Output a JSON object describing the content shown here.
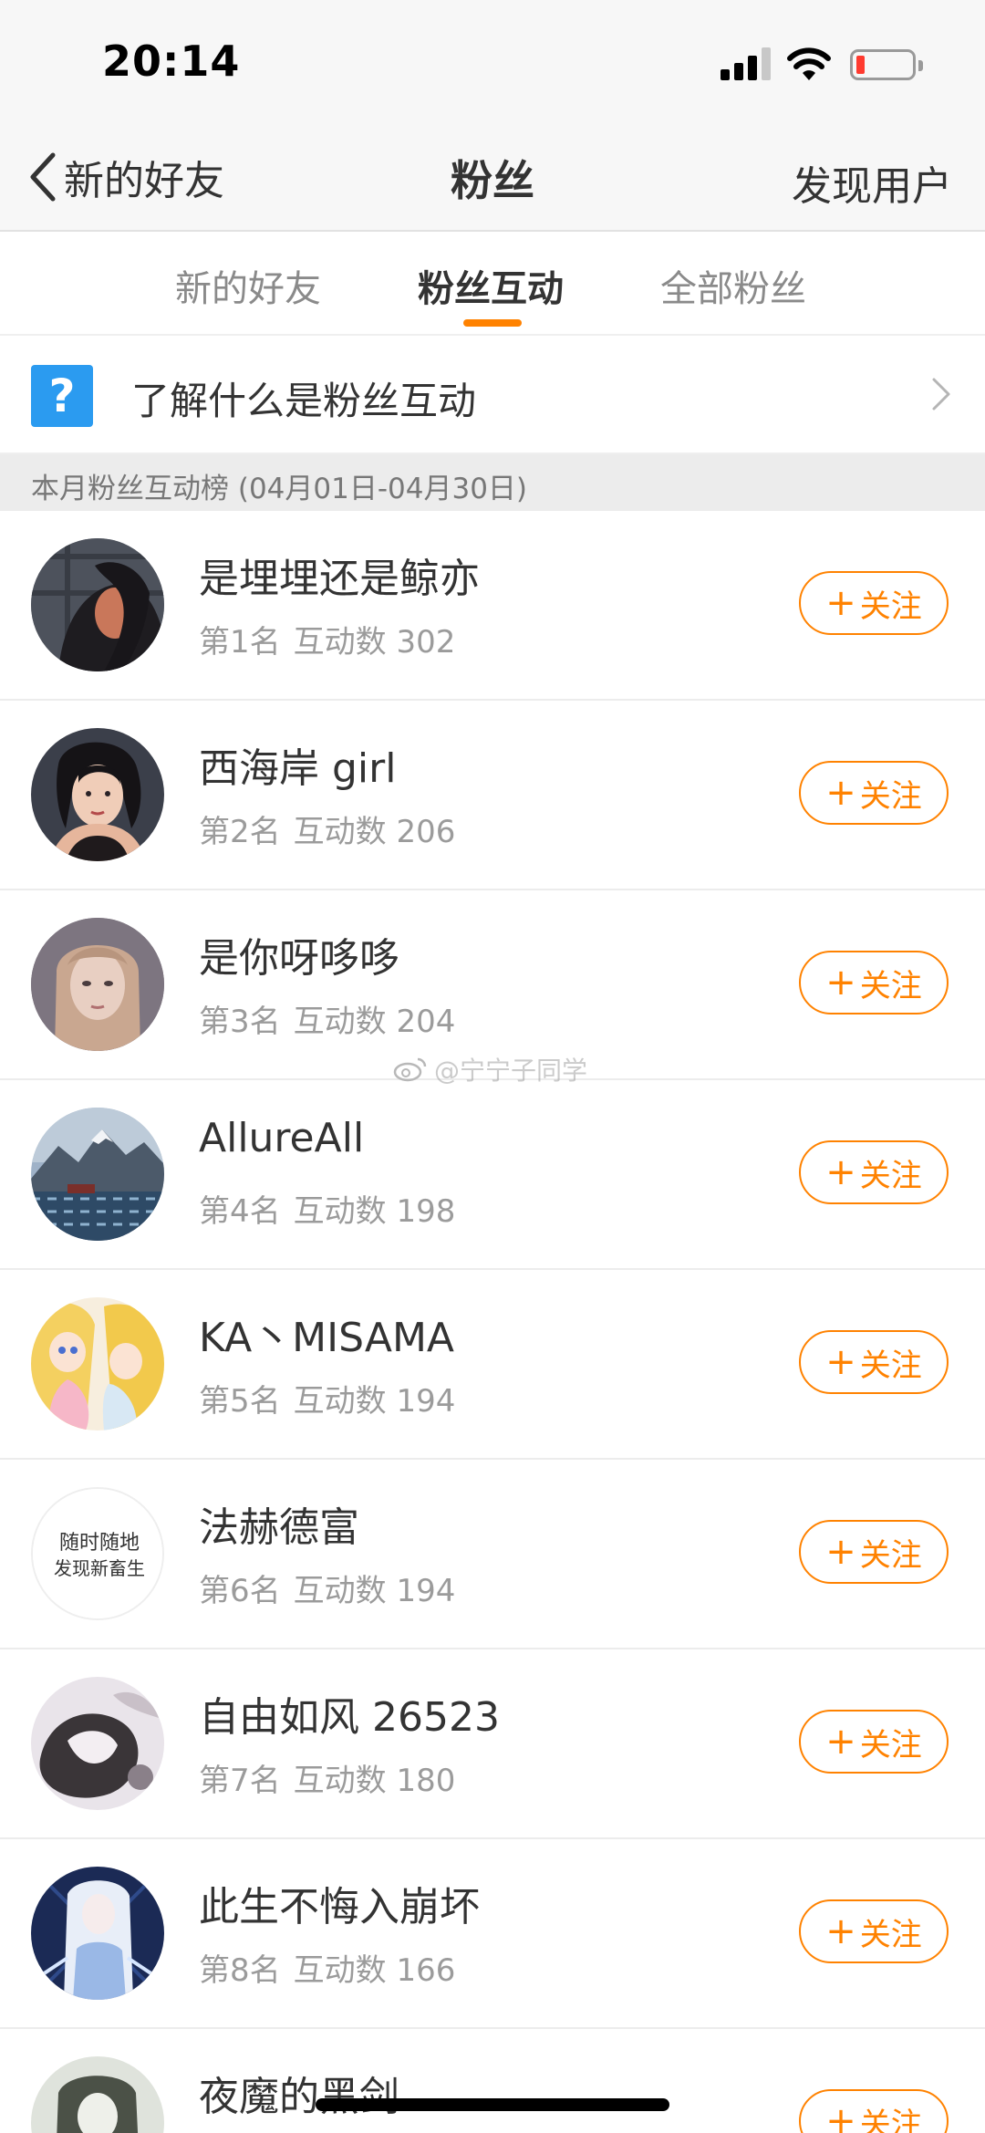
{
  "status_bar": {
    "time": "20:14",
    "battery_color": "#ff3b30"
  },
  "nav": {
    "back_label": "新的好友",
    "title": "粉丝",
    "right_action": "发现用户"
  },
  "tabs": [
    {
      "label": "新的好友",
      "active": false
    },
    {
      "label": "粉丝互动",
      "active": true
    },
    {
      "label": "全部粉丝",
      "active": false
    }
  ],
  "accent_color": "#ff8200",
  "help": {
    "icon": "question-icon",
    "text": "了解什么是粉丝互动"
  },
  "section_header": "本月粉丝互动榜 (04月01日-04月30日)",
  "follow_label": "关注",
  "watermark": "@宁宁子同学",
  "fans": [
    {
      "name": "是埋埋还是鲸亦",
      "rank": "第1名",
      "interaction": "互动数 302"
    },
    {
      "name": "西海岸 girl",
      "rank": "第2名",
      "interaction": "互动数 206"
    },
    {
      "name": "是你呀哆哆",
      "rank": "第3名",
      "interaction": "互动数 204"
    },
    {
      "name": "AllureAll",
      "rank": "第4名",
      "interaction": "互动数 198"
    },
    {
      "name": "KA丶MISAMA",
      "rank": "第5名",
      "interaction": "互动数 194"
    },
    {
      "name": "法赫德富",
      "rank": "第6名",
      "interaction": "互动数 194",
      "avatar_text": [
        "随时随地",
        "发现新畜生"
      ]
    },
    {
      "name": "自由如风 26523",
      "rank": "第7名",
      "interaction": "互动数 180"
    },
    {
      "name": "此生不悔入崩坏",
      "rank": "第8名",
      "interaction": "互动数 166"
    },
    {
      "name": "夜魔的黑剑",
      "rank": "",
      "interaction": ""
    }
  ]
}
